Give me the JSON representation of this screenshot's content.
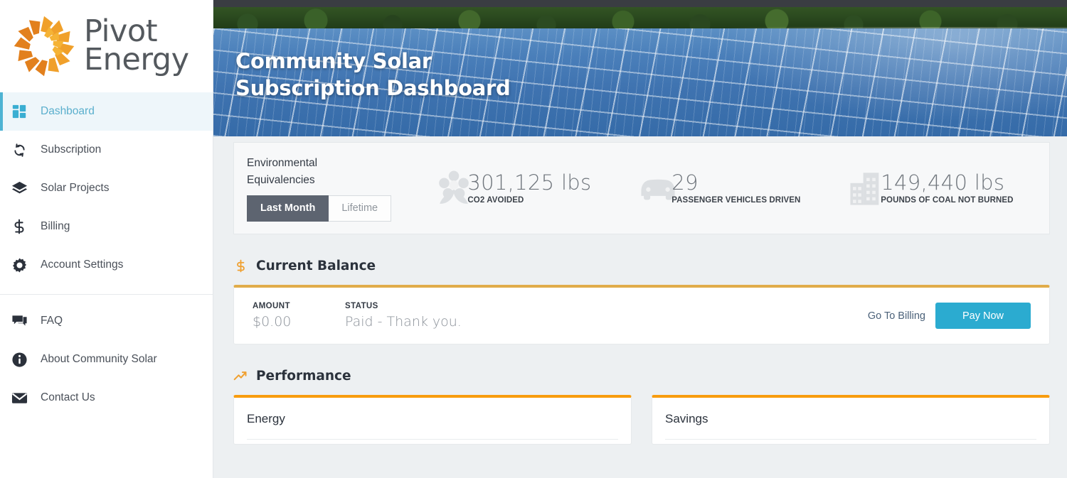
{
  "brand": {
    "name_line1": "Pivot",
    "name_line2": "Energy",
    "logo_icon": "pinwheel-sun-icon",
    "accent_orange": "#e8881f",
    "accent_gold": "#e0ac4a",
    "accent_cyan": "#2babd0"
  },
  "sidebar": {
    "primary_items": [
      {
        "label": "Dashboard",
        "icon": "grid-dashboard-icon",
        "active": true
      },
      {
        "label": "Subscription",
        "icon": "sync-refresh-icon",
        "active": false
      },
      {
        "label": "Solar Projects",
        "icon": "layers-stack-icon",
        "active": false
      },
      {
        "label": "Billing",
        "icon": "dollar-sign-icon",
        "active": false
      },
      {
        "label": "Account Settings",
        "icon": "gear-icon",
        "active": false
      }
    ],
    "secondary_items": [
      {
        "label": "FAQ",
        "icon": "chat-bubbles-icon"
      },
      {
        "label": "About Community Solar",
        "icon": "info-circle-icon"
      },
      {
        "label": "Contact Us",
        "icon": "envelope-icon"
      }
    ]
  },
  "hero": {
    "title_line1": "Community Solar",
    "title_line2": "Subscription Dashboard",
    "background_image": "solar-panel-array-photo"
  },
  "environmental": {
    "title_line1": "Environmental",
    "title_line2": "Equivalencies",
    "toggle": {
      "active_label": "Last Month",
      "inactive_label": "Lifetime"
    },
    "metrics": [
      {
        "value": "301,125 lbs",
        "label": "CO2 AVOIDED",
        "icon": "flower-icon"
      },
      {
        "value": "29",
        "label": "PASSENGER VEHICLES DRIVEN",
        "icon": "car-icon"
      },
      {
        "value": "149,440 lbs",
        "label": "POUNDS OF COAL NOT BURNED",
        "icon": "building-icon"
      }
    ]
  },
  "balance": {
    "section_title": "Current Balance",
    "section_icon": "dollar-sign-icon",
    "amount_key": "AMOUNT",
    "amount_value": "$0.00",
    "status_key": "STATUS",
    "status_value": "Paid - Thank you.",
    "go_to_billing_label": "Go To Billing",
    "pay_now_label": "Pay Now"
  },
  "performance": {
    "section_title": "Performance",
    "section_icon": "trending-up-icon",
    "cards": [
      {
        "title": "Energy"
      },
      {
        "title": "Savings"
      }
    ]
  }
}
